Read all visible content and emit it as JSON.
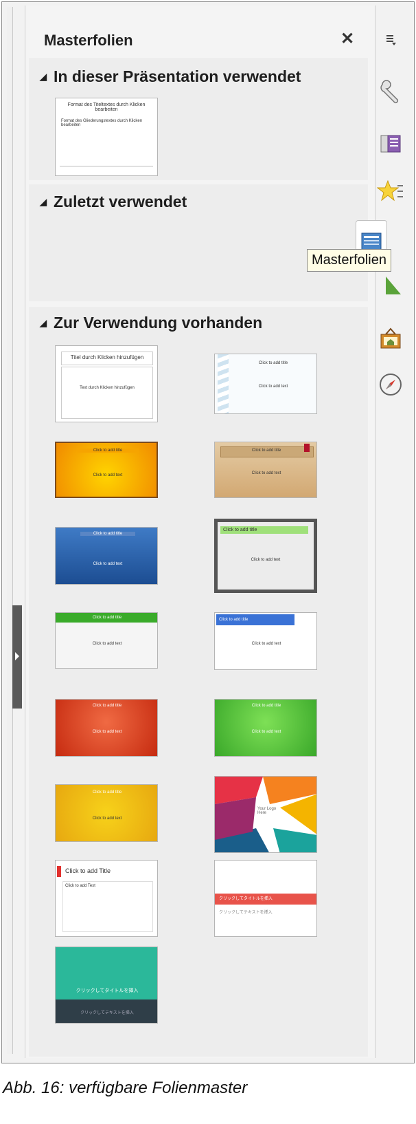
{
  "panel": {
    "title": "Masterfolien",
    "close_glyph": "✕"
  },
  "sections": [
    {
      "label": "In dieser Präsentation verwendet"
    },
    {
      "label": "Zuletzt verwendet"
    },
    {
      "label": "Zur Verwendung vorhanden"
    }
  ],
  "used_thumb": {
    "title": "Format des Titeltextes durch Klicken bearbeiten",
    "body": "Format des Gliederungstextes durch Klicken bearbeiten"
  },
  "available_thumbs": [
    {
      "title": "Titel durch Klicken hinzufügen",
      "body": "Text durch Klicken hinzufügen"
    },
    {
      "title": "Click to add title",
      "body": "Click to add text"
    },
    {
      "title": "Click to add title",
      "body": "Click to add text"
    },
    {
      "title": "Click to add title",
      "body": "Click to add text"
    },
    {
      "title": "Click to add title",
      "body": "Click to add text"
    },
    {
      "title": "Click to add title",
      "body": "Click to add text"
    },
    {
      "title": "Click to add title",
      "body": "Click to add text"
    },
    {
      "title": "Click to add title",
      "body": "Click to add text"
    },
    {
      "title": "Click to add title",
      "body": "Click to add text"
    },
    {
      "title": "Click to add title",
      "body": "Click to add text"
    },
    {
      "title": "Click to add title",
      "body": "Click to add text"
    },
    {
      "title": "Your Logo Here",
      "body": ""
    },
    {
      "title": "Click to add Title",
      "body": "Click to add Text"
    },
    {
      "title": "クリックしてタイトルを挿入",
      "body": "クリックしてテキストを挿入"
    },
    {
      "title": "クリックしてタイトルを挿入",
      "body": "クリックしてテキストを挿入"
    }
  ],
  "tabs": [
    {
      "icon": "menu-icon"
    },
    {
      "icon": "wrench-icon"
    },
    {
      "icon": "slide-transition-icon"
    },
    {
      "icon": "animation-star-icon"
    },
    {
      "icon": "master-slides-icon"
    },
    {
      "icon": "gallery-icon"
    },
    {
      "icon": "navigator-icon"
    }
  ],
  "tooltip": "Masterfolien",
  "caption": "Abb. 16: verfügbare Folienmaster"
}
